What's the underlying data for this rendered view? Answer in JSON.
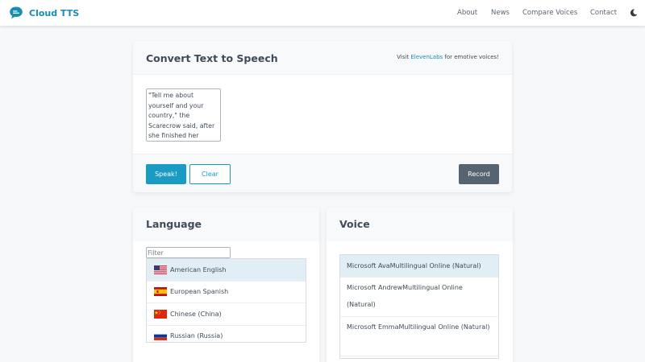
{
  "brand": {
    "name": "Cloud TTS",
    "icon": "chat-bubble-icon"
  },
  "nav": {
    "links": [
      "About",
      "News",
      "Compare Voices",
      "Contact"
    ],
    "theme_toggle_icon": "moon-icon"
  },
  "tts": {
    "title": "Convert Text to Speech",
    "promo_prefix": "Visit ",
    "promo_link": "ElevenLabs",
    "promo_suffix": " for emotive voices!",
    "text_value": "\"Tell me about yourself and your country,\" the Scarecrow said, after she finished her",
    "speak_label": "Speak!",
    "clear_label": "Clear",
    "record_label": "Record"
  },
  "language": {
    "title": "Language",
    "filter_placeholder": "Filter",
    "items": [
      {
        "label": "American English",
        "flag": "us-flag-icon",
        "selected": true
      },
      {
        "label": "European Spanish",
        "flag": "spain-flag-icon",
        "selected": false
      },
      {
        "label": "Chinese (China)",
        "flag": "china-flag-icon",
        "selected": false
      },
      {
        "label": "Russian (Russia)",
        "flag": "russia-flag-icon",
        "selected": false
      }
    ]
  },
  "voice": {
    "title": "Voice",
    "items": [
      {
        "label": "Microsoft AvaMultilingual Online (Natural)",
        "selected": true
      },
      {
        "label": "Microsoft AndrewMultilingual Online (Natural)",
        "selected": false
      },
      {
        "label": "Microsoft EmmaMultilingual Online (Natural)",
        "selected": false
      }
    ]
  },
  "colors": {
    "accent": "#1a9bc4",
    "brand_text": "#168db2",
    "record_button": "#566370",
    "selected_row": "#e1eef5",
    "page_background": "#f6f8fa"
  }
}
